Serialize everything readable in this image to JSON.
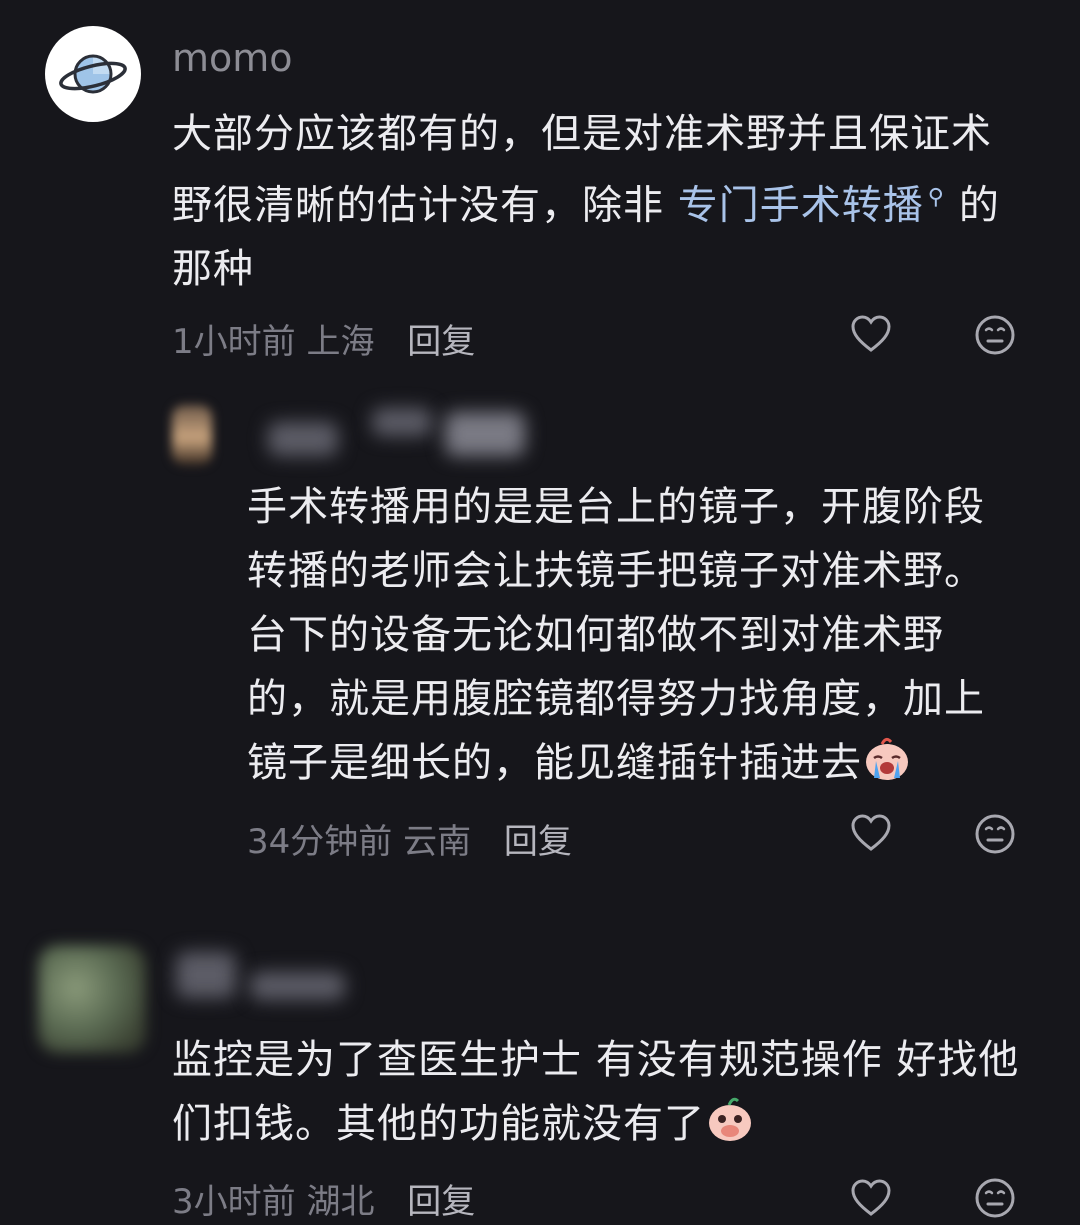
{
  "comments": [
    {
      "username": "momo",
      "text_lines": [
        "大部分应该都有的，但是对准术野并且保证术",
        "野很清晰的估计没有，除非 ",
        "那种"
      ],
      "link_text": "专门手术转播",
      "after_link": "的",
      "time": "1小时前",
      "location": "上海",
      "reply_label": "回复"
    },
    {
      "username": "",
      "text_lines": [
        "手术转播用的是是台上的镜子，开腹阶段",
        "转播的老师会让扶镜手把镜子对准术野。",
        "台下的设备无论如何都做不到对准术野",
        "的，就是用腹腔镜都得努力找角度，加上",
        "镜子是细长的，能见缝插针插进去"
      ],
      "time": "34分钟前",
      "location": "云南",
      "reply_label": "回复"
    },
    {
      "username": "",
      "text_lines": [
        "监控是为了查医生护士 有没有规范操作 好找他",
        "们扣钱。其他的功能就没有了"
      ],
      "time": "3小时前",
      "location": "湖北",
      "reply_label": "回复"
    }
  ],
  "icons": {
    "like": "heart-outline-icon",
    "react": "neutral-face-icon",
    "search": "search-icon",
    "emoji_cry": "crying-face-emoji",
    "emoji_cover": "covering-mouth-emoji"
  },
  "colors": {
    "background": "#16161b",
    "text": "#ececf0",
    "meta": "#7c7c86",
    "link": "#a9c3e9",
    "reply": "#b6b6be"
  }
}
